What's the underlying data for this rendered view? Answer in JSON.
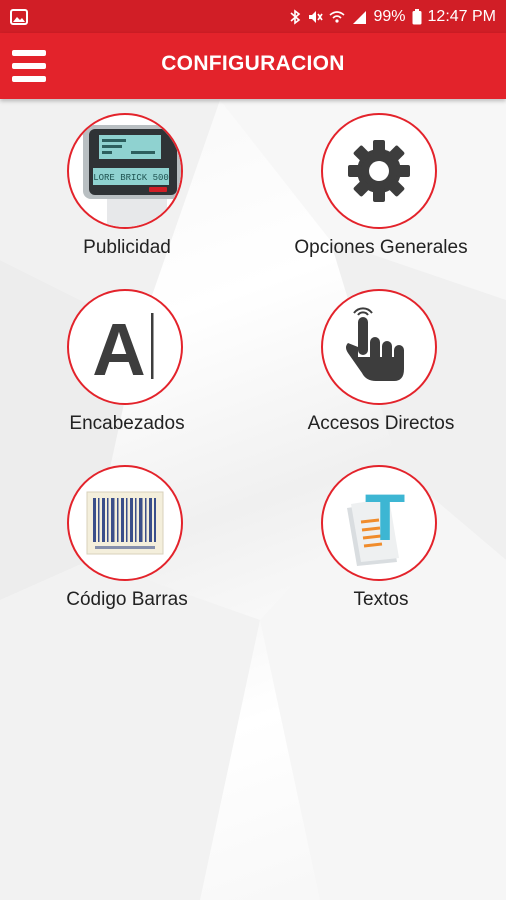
{
  "status_bar": {
    "time": "12:47 PM",
    "battery": "99%"
  },
  "toolbar": {
    "title": "CONFIGURACION"
  },
  "options": [
    {
      "label": "Publicidad",
      "icon": "scale-display-icon",
      "display_lines": [
        "LORE BRICK 500"
      ]
    },
    {
      "label": "Opciones Generales",
      "icon": "gear-icon"
    },
    {
      "label": "Encabezados",
      "icon": "letter-a-cursor-icon",
      "glyph": "A"
    },
    {
      "label": "Accesos Directos",
      "icon": "tap-hand-icon"
    },
    {
      "label": "Código Barras",
      "icon": "barcode-icon"
    },
    {
      "label": "Textos",
      "icon": "text-document-icon",
      "glyph": "T"
    }
  ],
  "colors": {
    "accent": "#e3232b",
    "statusbar": "#d11e26",
    "icon_dark": "#3d3d3d"
  }
}
